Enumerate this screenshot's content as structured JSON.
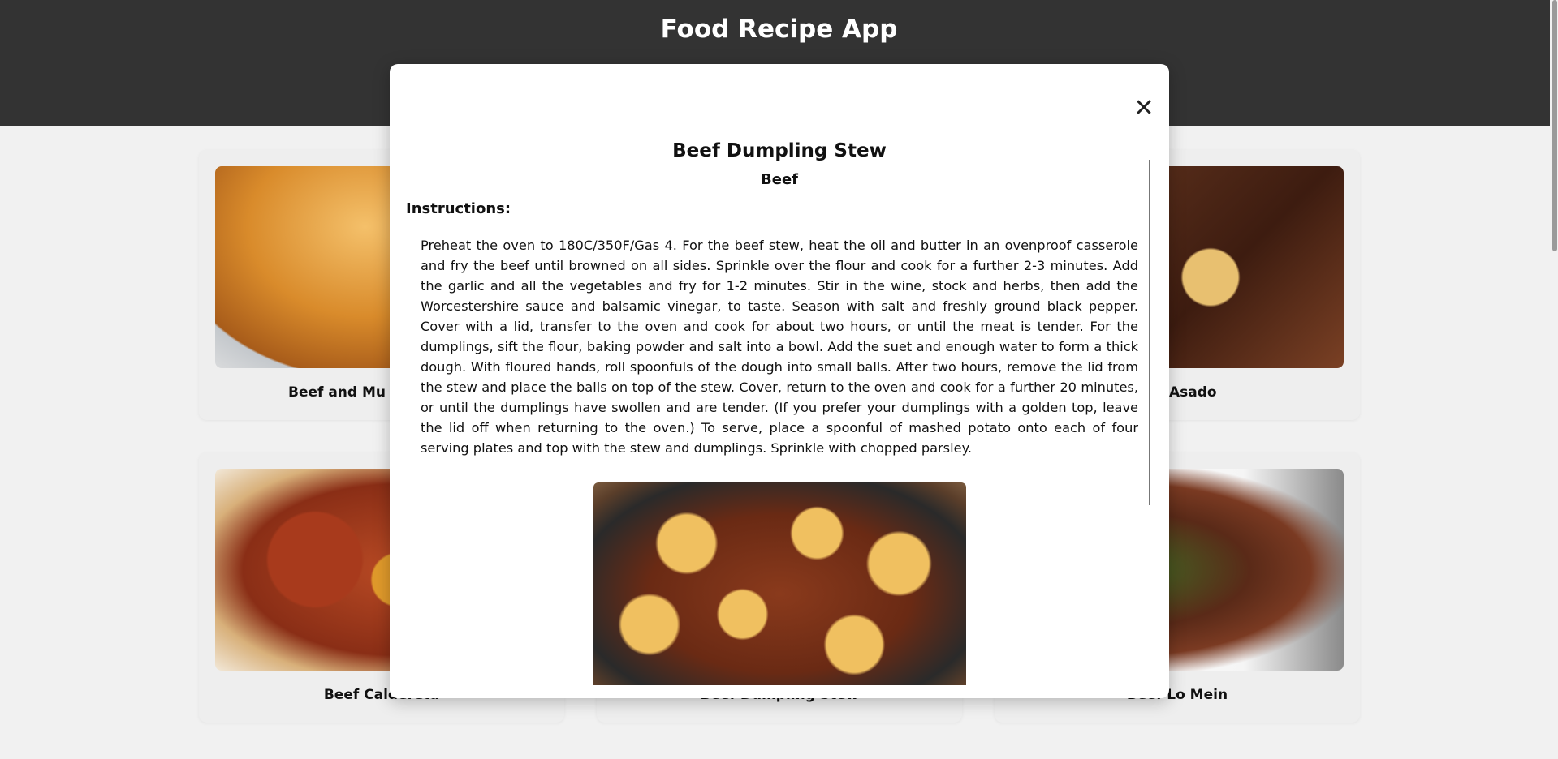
{
  "app": {
    "title": "Food Recipe App"
  },
  "cards": [
    {
      "label": "Beef and Mu"
    },
    {
      "label": "Asado"
    },
    {
      "label": "Beef Caldereta"
    },
    {
      "label": "Beef Dumpling Stew"
    },
    {
      "label": "Beef Lo Mein"
    }
  ],
  "modal": {
    "close_icon": "✕",
    "title": "Beef Dumpling Stew",
    "category": "Beef",
    "instructions_heading": "Instructions:",
    "instructions": "Preheat the oven to 180C/350F/Gas 4. For the beef stew, heat the oil and butter in an ovenproof casserole and fry the beef until browned on all sides. Sprinkle over the flour and cook for a further 2-3 minutes. Add the garlic and all the vegetables and fry for 1-2 minutes. Stir in the wine, stock and herbs, then add the Worcestershire sauce and balsamic vinegar, to taste. Season with salt and freshly ground black pepper. Cover with a lid, transfer to the oven and cook for about two hours, or until the meat is tender. For the dumplings, sift the flour, baking powder and salt into a bowl. Add the suet and enough water to form a thick dough. With floured hands, roll spoonfuls of the dough into small balls. After two hours, remove the lid from the stew and place the balls on top of the stew. Cover, return to the oven and cook for a further 20 minutes, or until the dumplings have swollen and are tender. (If you prefer your dumplings with a golden top, leave the lid off when returning to the oven.) To serve, place a spoonful of mashed potato onto each of four serving plates and top with the stew and dumplings. Sprinkle with chopped parsley."
  }
}
